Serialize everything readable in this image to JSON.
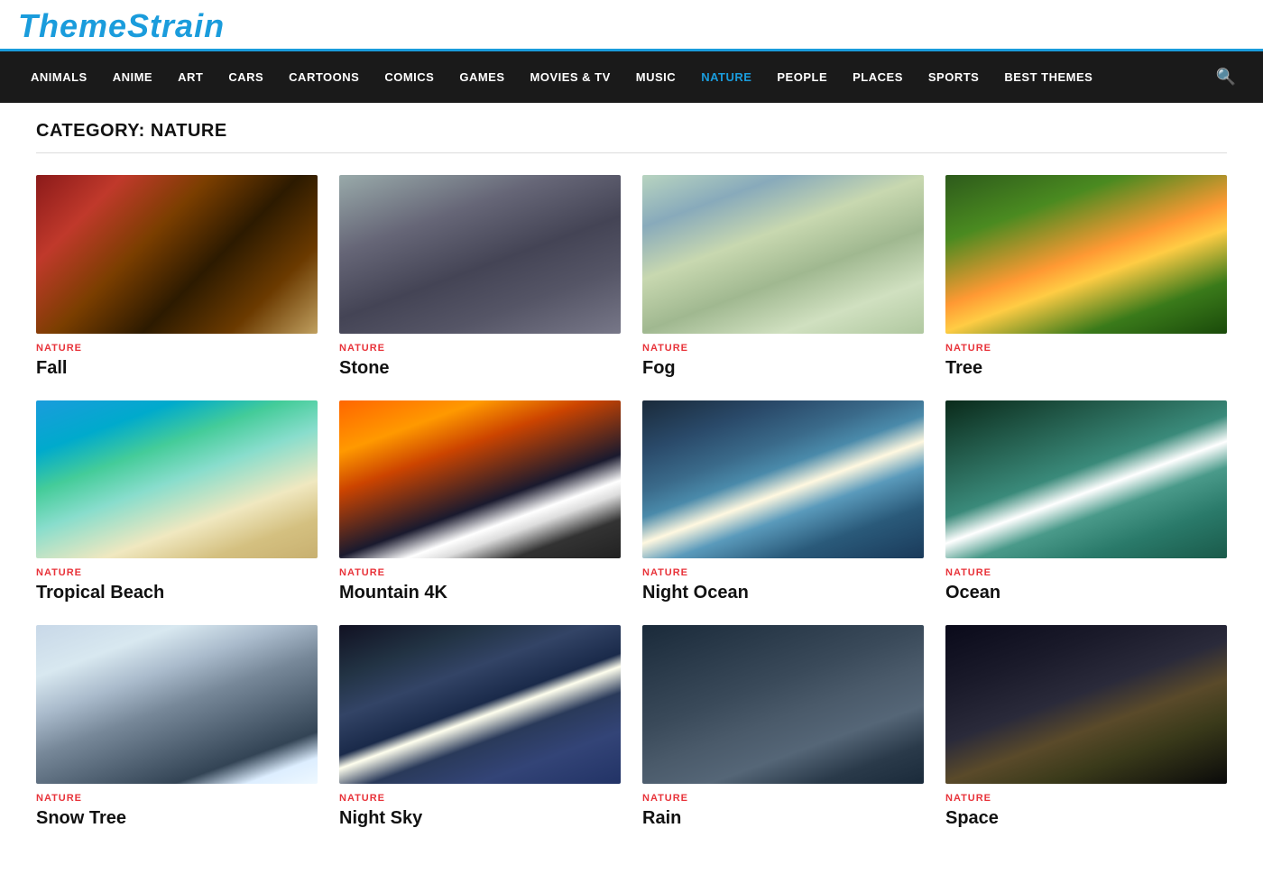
{
  "logo": {
    "text": "ThemeStrain"
  },
  "nav": {
    "items": [
      {
        "label": "ANIMALS",
        "active": false
      },
      {
        "label": "ANIME",
        "active": false
      },
      {
        "label": "ART",
        "active": false
      },
      {
        "label": "CARS",
        "active": false
      },
      {
        "label": "CARTOONS",
        "active": false
      },
      {
        "label": "COMICS",
        "active": false
      },
      {
        "label": "GAMES",
        "active": false
      },
      {
        "label": "MOVIES & TV",
        "active": false
      },
      {
        "label": "MUSIC",
        "active": false
      },
      {
        "label": "NATURE",
        "active": true
      },
      {
        "label": "PEOPLE",
        "active": false
      },
      {
        "label": "PLACES",
        "active": false
      },
      {
        "label": "SPORTS",
        "active": false
      },
      {
        "label": "BEST THEMES",
        "active": false
      }
    ]
  },
  "category": {
    "title": "CATEGORY: NATURE"
  },
  "cards": [
    {
      "id": "fall",
      "category": "NATURE",
      "title": "Fall",
      "img_class": "img-fall"
    },
    {
      "id": "stone",
      "category": "NATURE",
      "title": "Stone",
      "img_class": "img-stone"
    },
    {
      "id": "fog",
      "category": "NATURE",
      "title": "Fog",
      "img_class": "img-fog"
    },
    {
      "id": "tree",
      "category": "NATURE",
      "title": "Tree",
      "img_class": "img-tree"
    },
    {
      "id": "tropical-beach",
      "category": "NATURE",
      "title": "Tropical Beach",
      "img_class": "img-tropical-beach"
    },
    {
      "id": "mountain-4k",
      "category": "NATURE",
      "title": "Mountain 4K",
      "img_class": "img-mountain"
    },
    {
      "id": "night-ocean",
      "category": "NATURE",
      "title": "Night Ocean",
      "img_class": "img-night-ocean"
    },
    {
      "id": "ocean",
      "category": "NATURE",
      "title": "Ocean",
      "img_class": "img-ocean"
    },
    {
      "id": "snow-tree",
      "category": "NATURE",
      "title": "Snow Tree",
      "img_class": "img-snow-tree"
    },
    {
      "id": "night-sky",
      "category": "NATURE",
      "title": "Night Sky",
      "img_class": "img-night-sky"
    },
    {
      "id": "rain",
      "category": "NATURE",
      "title": "Rain",
      "img_class": "img-rain"
    },
    {
      "id": "space",
      "category": "NATURE",
      "title": "Space",
      "img_class": "img-space"
    }
  ]
}
